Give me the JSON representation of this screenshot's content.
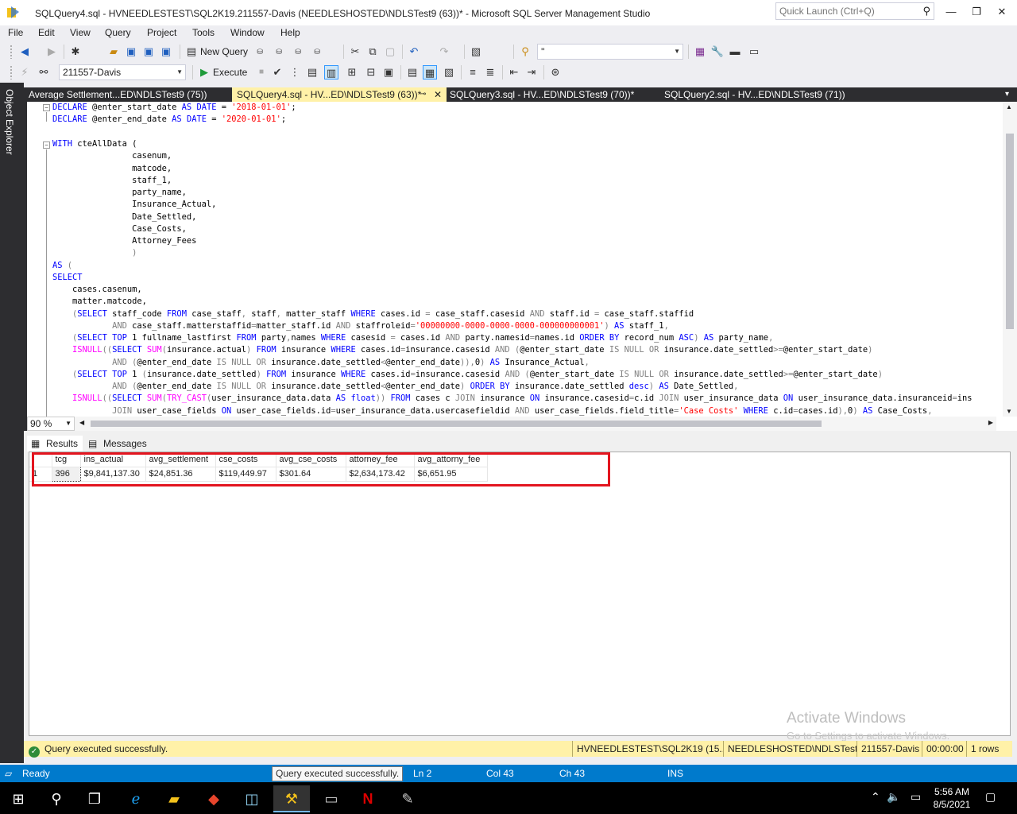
{
  "window": {
    "title": "SQLQuery4.sql - HVNEEDLESTEST\\SQL2K19.211557-Davis (NEEDLESHOSTED\\NDLSTest9 (63))* - Microsoft SQL Server Management Studio",
    "quick_launch_placeholder": "Quick Launch (Ctrl+Q)"
  },
  "menu": {
    "items": [
      "File",
      "Edit",
      "View",
      "Query",
      "Project",
      "Tools",
      "Window",
      "Help"
    ]
  },
  "toolbar": {
    "new_query_label": "New Query",
    "execute_label": "Execute",
    "database_value": "211557-Davis",
    "search_combo_value": "''"
  },
  "side": {
    "object_explorer_label": "Object Explorer"
  },
  "tabs": [
    {
      "label": "Average Settlement...ED\\NDLSTest9 (75))",
      "active": false
    },
    {
      "label": "SQLQuery4.sql - HV...ED\\NDLSTest9 (63))*",
      "active": true
    },
    {
      "label": "SQLQuery3.sql - HV...ED\\NDLSTest9 (70))*",
      "active": false
    },
    {
      "label": "SQLQuery2.sql - HV...ED\\NDLSTest9 (71))",
      "active": false
    }
  ],
  "editor": {
    "zoom": "90 %",
    "lines": [
      "DECLARE @enter_start_date AS DATE = '2018-01-01';",
      "DECLARE @enter_end_date AS DATE = '2020-01-01';",
      "",
      "WITH cteAllData (",
      "                casenum,",
      "                matcode,",
      "                staff_1,",
      "                party_name,",
      "                Insurance_Actual,",
      "                Date_Settled,",
      "                Case_Costs,",
      "                Attorney_Fees",
      "                )",
      "AS (",
      "SELECT",
      "    cases.casenum,",
      "    matter.matcode,",
      "    (SELECT staff_code FROM case_staff, staff, matter_staff WHERE cases.id = case_staff.casesid AND staff.id = case_staff.staffid",
      "            AND case_staff.matterstaffid=matter_staff.id AND staffroleid='00000000-0000-0000-0000-000000000001') AS staff_1,",
      "    (SELECT TOP 1 fullname_lastfirst FROM party,names WHERE casesid = cases.id AND party.namesid=names.id ORDER BY record_num ASC) AS party_name,",
      "    ISNULL((SELECT SUM(insurance.actual) FROM insurance WHERE cases.id=insurance.casesid AND (@enter_start_date IS NULL OR insurance.date_settled>=@enter_start_date)",
      "            AND (@enter_end_date IS NULL OR insurance.date_settled<@enter_end_date)),0) AS Insurance_Actual,",
      "    (SELECT TOP 1 (insurance.date_settled) FROM insurance WHERE cases.id=insurance.casesid AND (@enter_start_date IS NULL OR insurance.date_settled>=@enter_start_date)",
      "            AND (@enter_end_date IS NULL OR insurance.date_settled<@enter_end_date) ORDER BY insurance.date_settled desc) AS Date_Settled,",
      "    ISNULL((SELECT SUM(TRY_CAST(user_insurance_data.data AS float)) FROM cases c JOIN insurance ON insurance.casesid=c.id JOIN user_insurance_data ON user_insurance_data.insuranceid=ins",
      "            JOIN user_case_fields ON user_case_fields.id=user_insurance_data.usercasefieldid AND user_case_fields.field_title='Case Costs' WHERE c.id=cases.id),0) AS Case_Costs,"
    ]
  },
  "results": {
    "tabs": [
      "Results",
      "Messages"
    ],
    "columns": [
      "tcg",
      "ins_actual",
      "avg_settlement",
      "cse_costs",
      "avg_cse_costs",
      "attorney_fee",
      "avg_attorny_fee"
    ],
    "rows": [
      {
        "row_number": "1",
        "cells": [
          "396",
          "$9,841,137.30",
          "$24,851.36",
          "$119,449.97",
          "$301.64",
          "$2,634,173.42",
          "$6,651.95"
        ]
      }
    ]
  },
  "query_status": {
    "message": "Query executed successfully.",
    "server": "HVNEEDLESTEST\\SQL2K19 (15....",
    "login": "NEEDLESHOSTED\\NDLSTest...",
    "database": "211557-Davis",
    "elapsed": "00:00:00",
    "rows": "1 rows"
  },
  "status_bar": {
    "state": "Ready",
    "tooltip": "Query executed successfully.",
    "line": "Ln 2",
    "col": "Col 43",
    "ch": "Ch 43",
    "mode": "INS"
  },
  "watermark": {
    "title": "Activate Windows",
    "subtitle": "Go to Settings to activate Windows."
  },
  "clock": {
    "time": "5:56 AM",
    "date": "8/5/2021"
  },
  "colors": {
    "accent": "#007acc",
    "active_tab": "#fff1a8",
    "highlight_box": "#e3151f"
  }
}
